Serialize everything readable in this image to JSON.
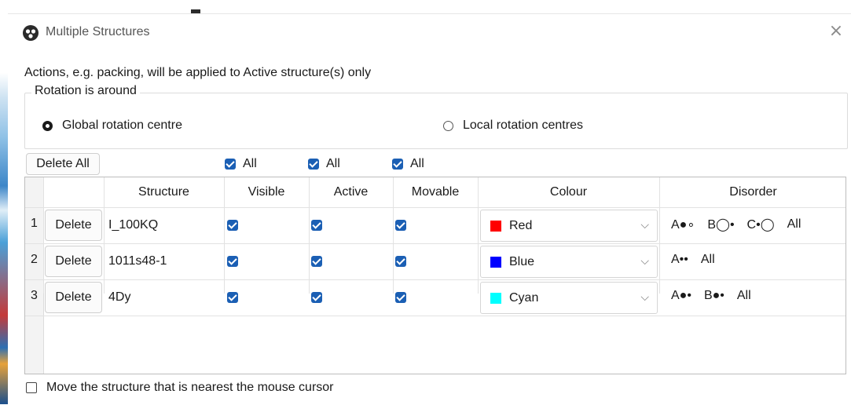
{
  "window": {
    "title": "Multiple Structures",
    "close_glyph": "×"
  },
  "hint": "Actions, e.g. packing, will be applied to Active structure(s) only",
  "rotation": {
    "group_title": "Rotation is around",
    "option_global": "Global rotation centre",
    "option_local": "Local rotation centres",
    "selected": "global"
  },
  "toolbar": {
    "delete_all_label": "Delete All",
    "all_label": "All"
  },
  "table": {
    "headers": [
      "Structure",
      "Visible",
      "Active",
      "Movable",
      "Colour",
      "Disorder"
    ],
    "rows": [
      {
        "num": "1",
        "delete_label": "Delete",
        "structure": "I_100KQ",
        "visible": true,
        "active": true,
        "movable": true,
        "colour": "Red",
        "swatch": "#ff0000",
        "disorder": [
          "A●∘",
          "B◯•",
          "C•◯",
          "All"
        ]
      },
      {
        "num": "2",
        "delete_label": "Delete",
        "structure": "1011s48-1",
        "visible": true,
        "active": true,
        "movable": true,
        "colour": "Blue",
        "swatch": "#0000ff",
        "disorder": [
          "A••",
          "All"
        ]
      },
      {
        "num": "3",
        "delete_label": "Delete",
        "structure": "4Dy",
        "visible": true,
        "active": true,
        "movable": true,
        "colour": "Cyan",
        "swatch": "#00ffff",
        "disorder": [
          "A●•",
          "B●•",
          "All"
        ]
      }
    ]
  },
  "footer": {
    "move_nearest_label": "Move the structure that is nearest the mouse cursor",
    "checked": false
  },
  "colors": {
    "accent": "#1b5fb4"
  }
}
